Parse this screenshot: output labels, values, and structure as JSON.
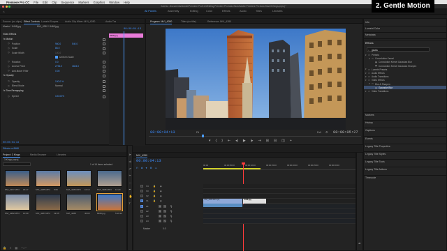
{
  "overlay_label": "2. Gentle Motion",
  "menubar": {
    "apple": "",
    "items": [
      "Premiere Pro CC",
      "File",
      "Edit",
      "Clip",
      "Sequence",
      "Markers",
      "Graphics",
      "Window",
      "Help"
    ]
  },
  "window_title": "/Users/...Documents/Adobe/Premiere Pro/11.0/Editing Premiere Pro Auto-Save/Adobe Premiere Pro Auto-Save/3 Kings.prproj *",
  "workspaces": [
    {
      "label": "All Panels",
      "active": true
    },
    {
      "label": "Assembly",
      "active": false
    },
    {
      "label": "Editing",
      "active": false
    },
    {
      "label": "Color",
      "active": false
    },
    {
      "label": "Effects",
      "active": false
    },
    {
      "label": "Audio",
      "active": false
    },
    {
      "label": "Titles",
      "active": false
    },
    {
      "label": "Libraries",
      "active": false
    }
  ],
  "effect_controls": {
    "tabs": [
      {
        "label": "Source: (no clips)",
        "active": false
      },
      {
        "label": "Effect Controls",
        "active": true
      },
      {
        "label": "Lumetri Scopes",
        "active": false
      },
      {
        "label": "Audio Clip Mixer: MVI_4280",
        "active": false
      },
      {
        "label": "Audio Tra",
        "active": false
      }
    ],
    "source_line": "Master * 8468.jpg",
    "clip_line": "MVI_4280 * 8468.jpg",
    "timecode_top": "00:00:04:13",
    "clip_bar_label": "8468.jpg",
    "section": "Video Effects",
    "rows": [
      {
        "label": "fx Motion",
        "value": "",
        "value2": "",
        "kind": "header"
      },
      {
        "label": "Position",
        "value": "960.0",
        "value2": "540.0",
        "kind": "blue"
      },
      {
        "label": "Scale",
        "value": "86.0",
        "value2": "",
        "kind": "blue"
      },
      {
        "label": "Scale Width",
        "value": "100.0",
        "value2": "",
        "kind": "dim"
      },
      {
        "label": "",
        "value": "",
        "value2": "Uniform Scale",
        "kind": "check"
      },
      {
        "label": "Rotation",
        "value": "0.0",
        "value2": "",
        "kind": "blue"
      },
      {
        "label": "Anchor Point",
        "value": "2736.0",
        "value2": "1824.0",
        "kind": "blue"
      },
      {
        "label": "Anti-flicker Filter",
        "value": "0.00",
        "value2": "",
        "kind": "blue"
      },
      {
        "label": "fx Opacity",
        "value": "",
        "value2": "",
        "kind": "header"
      },
      {
        "label": "Opacity",
        "value": "100.0 %",
        "value2": "",
        "kind": "blue"
      },
      {
        "label": "Blend Mode",
        "value": "Normal",
        "value2": "",
        "kind": "plain"
      },
      {
        "label": "fx Time Remapping",
        "value": "",
        "value2": "",
        "kind": "header"
      },
      {
        "label": "Speed",
        "value": "100.00%",
        "value2": "",
        "kind": "blue"
      }
    ],
    "bottom_timecode": "00:00:04:13"
  },
  "program": {
    "tabs": [
      {
        "label": "Program: MVI_4280",
        "active": true
      },
      {
        "label": "Titles (no title)",
        "active": false
      },
      {
        "label": "Reference: MVI_4280",
        "active": false
      }
    ],
    "timecode_left": "00:00:04:13",
    "fit": "Fit",
    "quality": "Full",
    "timecode_right": "00:00:05:27"
  },
  "project": {
    "header": "Effects on 8468",
    "tabs": [
      {
        "label": "Project: 3 Kings",
        "active": true
      },
      {
        "label": "Media Browser",
        "active": false
      },
      {
        "label": "Libraries",
        "active": false
      }
    ],
    "file": "3 Kings.prproj",
    "count": "1 of 14 items selected",
    "items": [
      {
        "name": "MVI_4207.MP4",
        "dur": "18:17"
      },
      {
        "name": "MVI_4285.MP4",
        "dur": "5:06"
      },
      {
        "name": "MVI_4280.MP4",
        "dur": "10:12"
      },
      {
        "name": "MVI_4286.MP4",
        "dur": "13:20"
      },
      {
        "name": "MVI_4282.MP4",
        "dur": "10:09"
      },
      {
        "name": "MVI_4287.MP4",
        "dur": "19:05"
      },
      {
        "name": "MVI_4288",
        "dur": "40:03"
      },
      {
        "name": "8468.jpg",
        "dur": "5:19:12"
      }
    ]
  },
  "timeline": {
    "tab": "MVI_4280",
    "timecode": "00:00:04:13",
    "ruler": [
      "00:00",
      "00:00:05:00",
      "00:00:10:00",
      "00:00:15:00",
      "00:00:20:00",
      "00:00:25:00",
      "00:00:30:00"
    ],
    "video_tracks": [
      "V4",
      "V3",
      "V2",
      "V1"
    ],
    "audio_tracks": [
      "A1",
      "A2",
      "A3",
      "A4"
    ],
    "master_label": "Master",
    "master_value": "0.0",
    "clip_v1_label": "MVI_4280.MP4 [V]",
    "clip_v2_label": "8468.jpg",
    "clip_a1_label": ""
  },
  "effects_panel": {
    "items_top": [
      "Info",
      "Lumetri Color",
      "Metadata"
    ],
    "title": "Effects",
    "search": "gauss",
    "tree": [
      {
        "label": "Presets",
        "indent": 0,
        "kind": "folder"
      },
      {
        "label": "Convolution Kernel",
        "indent": 1,
        "kind": "folder"
      },
      {
        "label": "Convolution Kernel Gaussian Blur",
        "indent": 2,
        "kind": "item"
      },
      {
        "label": "Convolution Kernel Gaussian Sharpen",
        "indent": 2,
        "kind": "item"
      },
      {
        "label": "Lumetri Presets",
        "indent": 0,
        "kind": "folder"
      },
      {
        "label": "Audio Effects",
        "indent": 0,
        "kind": "folder"
      },
      {
        "label": "Audio Transitions",
        "indent": 0,
        "kind": "folder"
      },
      {
        "label": "Video Effects",
        "indent": 0,
        "kind": "folder"
      },
      {
        "label": "Blur & Sharpen",
        "indent": 1,
        "kind": "folder"
      },
      {
        "label": "Gaussian Blur",
        "indent": 2,
        "kind": "selected"
      },
      {
        "label": "Video Transitions",
        "indent": 0,
        "kind": "folder"
      }
    ],
    "sections": [
      "Markers",
      "History",
      "Captions",
      "Events",
      "Legacy Title Properties",
      "Legacy Title Styles",
      "Legacy Title Tools",
      "Legacy Title Actions",
      "Timecode"
    ]
  },
  "colors": {
    "accent": "#4b9bff",
    "clip_pink": "#e97bd9",
    "clip_video": "#8fa9d8",
    "clip_audio": "#5a8ec2",
    "playhead": "#ff3b3b"
  }
}
